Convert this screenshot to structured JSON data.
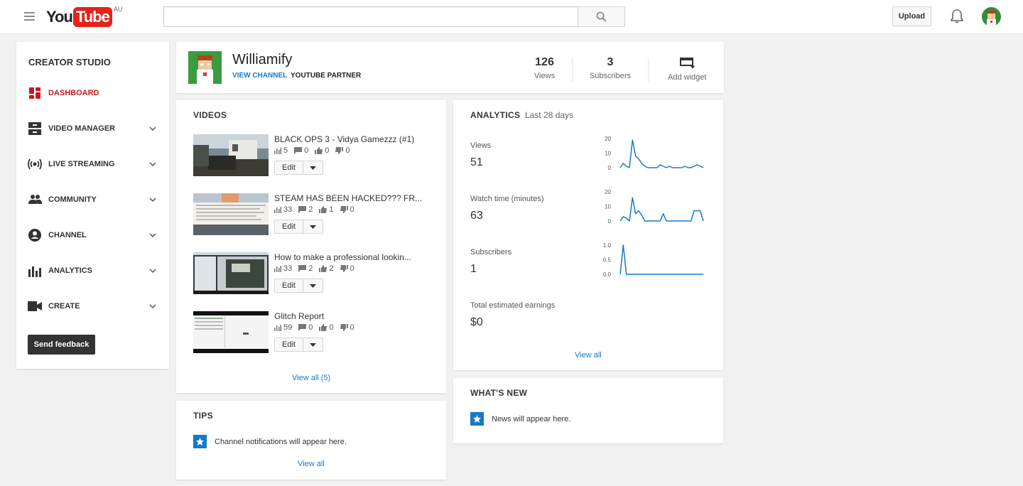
{
  "header": {
    "logo_you": "You",
    "logo_tube": "Tube",
    "logo_country": "AU",
    "search_placeholder": "",
    "upload_label": "Upload"
  },
  "sidebar": {
    "title": "CREATOR STUDIO",
    "items": [
      {
        "label": "DASHBOARD",
        "icon": "dashboard-icon",
        "active": true
      },
      {
        "label": "VIDEO MANAGER",
        "icon": "video-manager-icon"
      },
      {
        "label": "LIVE STREAMING",
        "icon": "live-streaming-icon"
      },
      {
        "label": "COMMUNITY",
        "icon": "community-icon"
      },
      {
        "label": "CHANNEL",
        "icon": "channel-icon"
      },
      {
        "label": "ANALYTICS",
        "icon": "analytics-icon"
      },
      {
        "label": "CREATE",
        "icon": "create-icon"
      }
    ],
    "feedback_label": "Send feedback"
  },
  "channel": {
    "name": "Williamify",
    "view_channel": "VIEW CHANNEL",
    "partner": "YOUTUBE PARTNER",
    "views_num": "126",
    "views_lbl": "Views",
    "subs_num": "3",
    "subs_lbl": "Subscribers",
    "widget_lbl": "Add widget"
  },
  "videos": {
    "title": "VIDEOS",
    "items": [
      {
        "title": "BLACK OPS 3 - Vidya Gamezzz (#1)",
        "views": "5",
        "comments": "0",
        "likes": "0",
        "dislikes": "0"
      },
      {
        "title": "STEAM HAS BEEN HACKED??? FR...",
        "views": "33",
        "comments": "2",
        "likes": "1",
        "dislikes": "0"
      },
      {
        "title": "How to make a professional lookin...",
        "views": "33",
        "comments": "2",
        "likes": "2",
        "dislikes": "0"
      },
      {
        "title": "Glitch Report",
        "views": "59",
        "comments": "0",
        "likes": "0",
        "dislikes": "0"
      }
    ],
    "edit_label": "Edit",
    "view_all": "View all (5)"
  },
  "analytics": {
    "title": "ANALYTICS",
    "subtitle": "Last 28 days",
    "metrics": [
      {
        "label": "Views",
        "value": "51"
      },
      {
        "label": "Watch time (minutes)",
        "value": "63"
      },
      {
        "label": "Subscribers",
        "value": "1"
      },
      {
        "label": "Total estimated earnings",
        "value": "$0"
      }
    ],
    "view_all": "View all"
  },
  "chart_data": [
    {
      "type": "line",
      "ylim": [
        0,
        20
      ],
      "yticks": [
        "20",
        "10",
        "0"
      ],
      "values": [
        0,
        3,
        1,
        0,
        19,
        8,
        6,
        3,
        1,
        0,
        0,
        0,
        0,
        2,
        1,
        0,
        1,
        0,
        0,
        0,
        0,
        1,
        0,
        0,
        1,
        2,
        1,
        0
      ]
    },
    {
      "type": "line",
      "ylim": [
        0,
        20
      ],
      "yticks": [
        "20",
        "10",
        "0"
      ],
      "values": [
        0,
        3,
        2,
        0,
        16,
        5,
        7,
        4,
        0,
        0,
        0,
        0,
        0,
        0,
        5,
        0,
        0,
        0,
        0,
        0,
        0,
        0,
        0,
        0,
        7,
        7,
        7,
        0
      ]
    },
    {
      "type": "line",
      "ylim": [
        0,
        1
      ],
      "yticks": [
        "1.0",
        "0.5",
        "0.0"
      ],
      "values": [
        0,
        1,
        0,
        0,
        0,
        0,
        0,
        0,
        0,
        0,
        0,
        0,
        0,
        0,
        0,
        0,
        0,
        0,
        0,
        0,
        0,
        0,
        0,
        0,
        0,
        0,
        0,
        0
      ]
    }
  ],
  "tips": {
    "title": "TIPS",
    "text": "Channel notifications will appear here.",
    "view_all": "View all"
  },
  "whatsnew": {
    "title": "WHAT'S NEW",
    "text": "News will appear here."
  },
  "colors": {
    "accent_red": "#cc181e",
    "link_blue": "#167ac6",
    "chart_blue": "#167ac6"
  }
}
